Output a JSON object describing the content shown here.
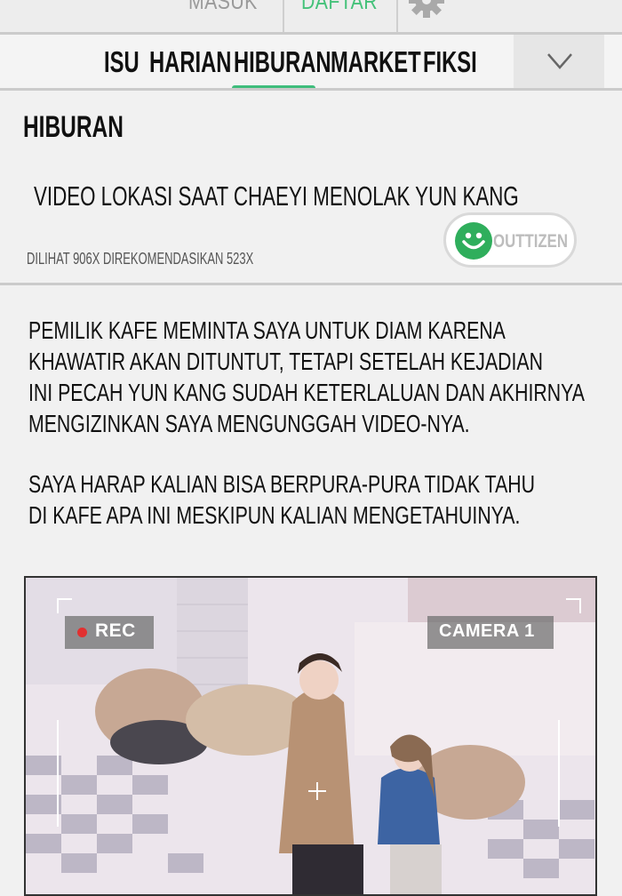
{
  "topbar": {
    "login_label": "MASUK",
    "register_label": "DAFTAR",
    "settings_icon": "gear-icon"
  },
  "nav": {
    "tabs": [
      {
        "label": "ISU"
      },
      {
        "label": "HARIAN"
      },
      {
        "label": "HIBURAN",
        "active": true
      },
      {
        "label": "MARKET"
      },
      {
        "label": "FIKSI"
      }
    ],
    "more_icon": "chevron-down-icon",
    "accent_color": "#3fbd7c"
  },
  "section": {
    "label": "HIBURAN"
  },
  "article": {
    "title": "VIDEO LOKASI SAAT CHAEYI MENOLAK YUN KANG",
    "meta": "DILIHAT 906X DIREKOMENDASIKAN 523X",
    "brand": {
      "icon": "smiley-icon",
      "label": "OUTTIZEN",
      "color": "#2fae5c"
    },
    "paragraphs": [
      [
        "PEMILIK KAFE MEMINTA SAYA UNTUK DIAM  KARENA",
        "KHAWATIR AKAN DITUNTUT, TETAPI SETELAH KEJADIAN",
        "INI PECAH YUN KANG SUDAH KETERLALUAN DAN AKHIRNYA",
        "MENGIZINKAN SAYA MENGUNGGAH VIDEO-NYA."
      ],
      [
        "SAYA HARAP KALIAN BISA BERPURA-PURA TIDAK TAHU",
        "DI KAFE APA INI MESKIPUN KALIAN MENGETAHUINYA."
      ]
    ]
  },
  "panel": {
    "rec_label": "REC",
    "camera_label": "CAMERA 1"
  }
}
